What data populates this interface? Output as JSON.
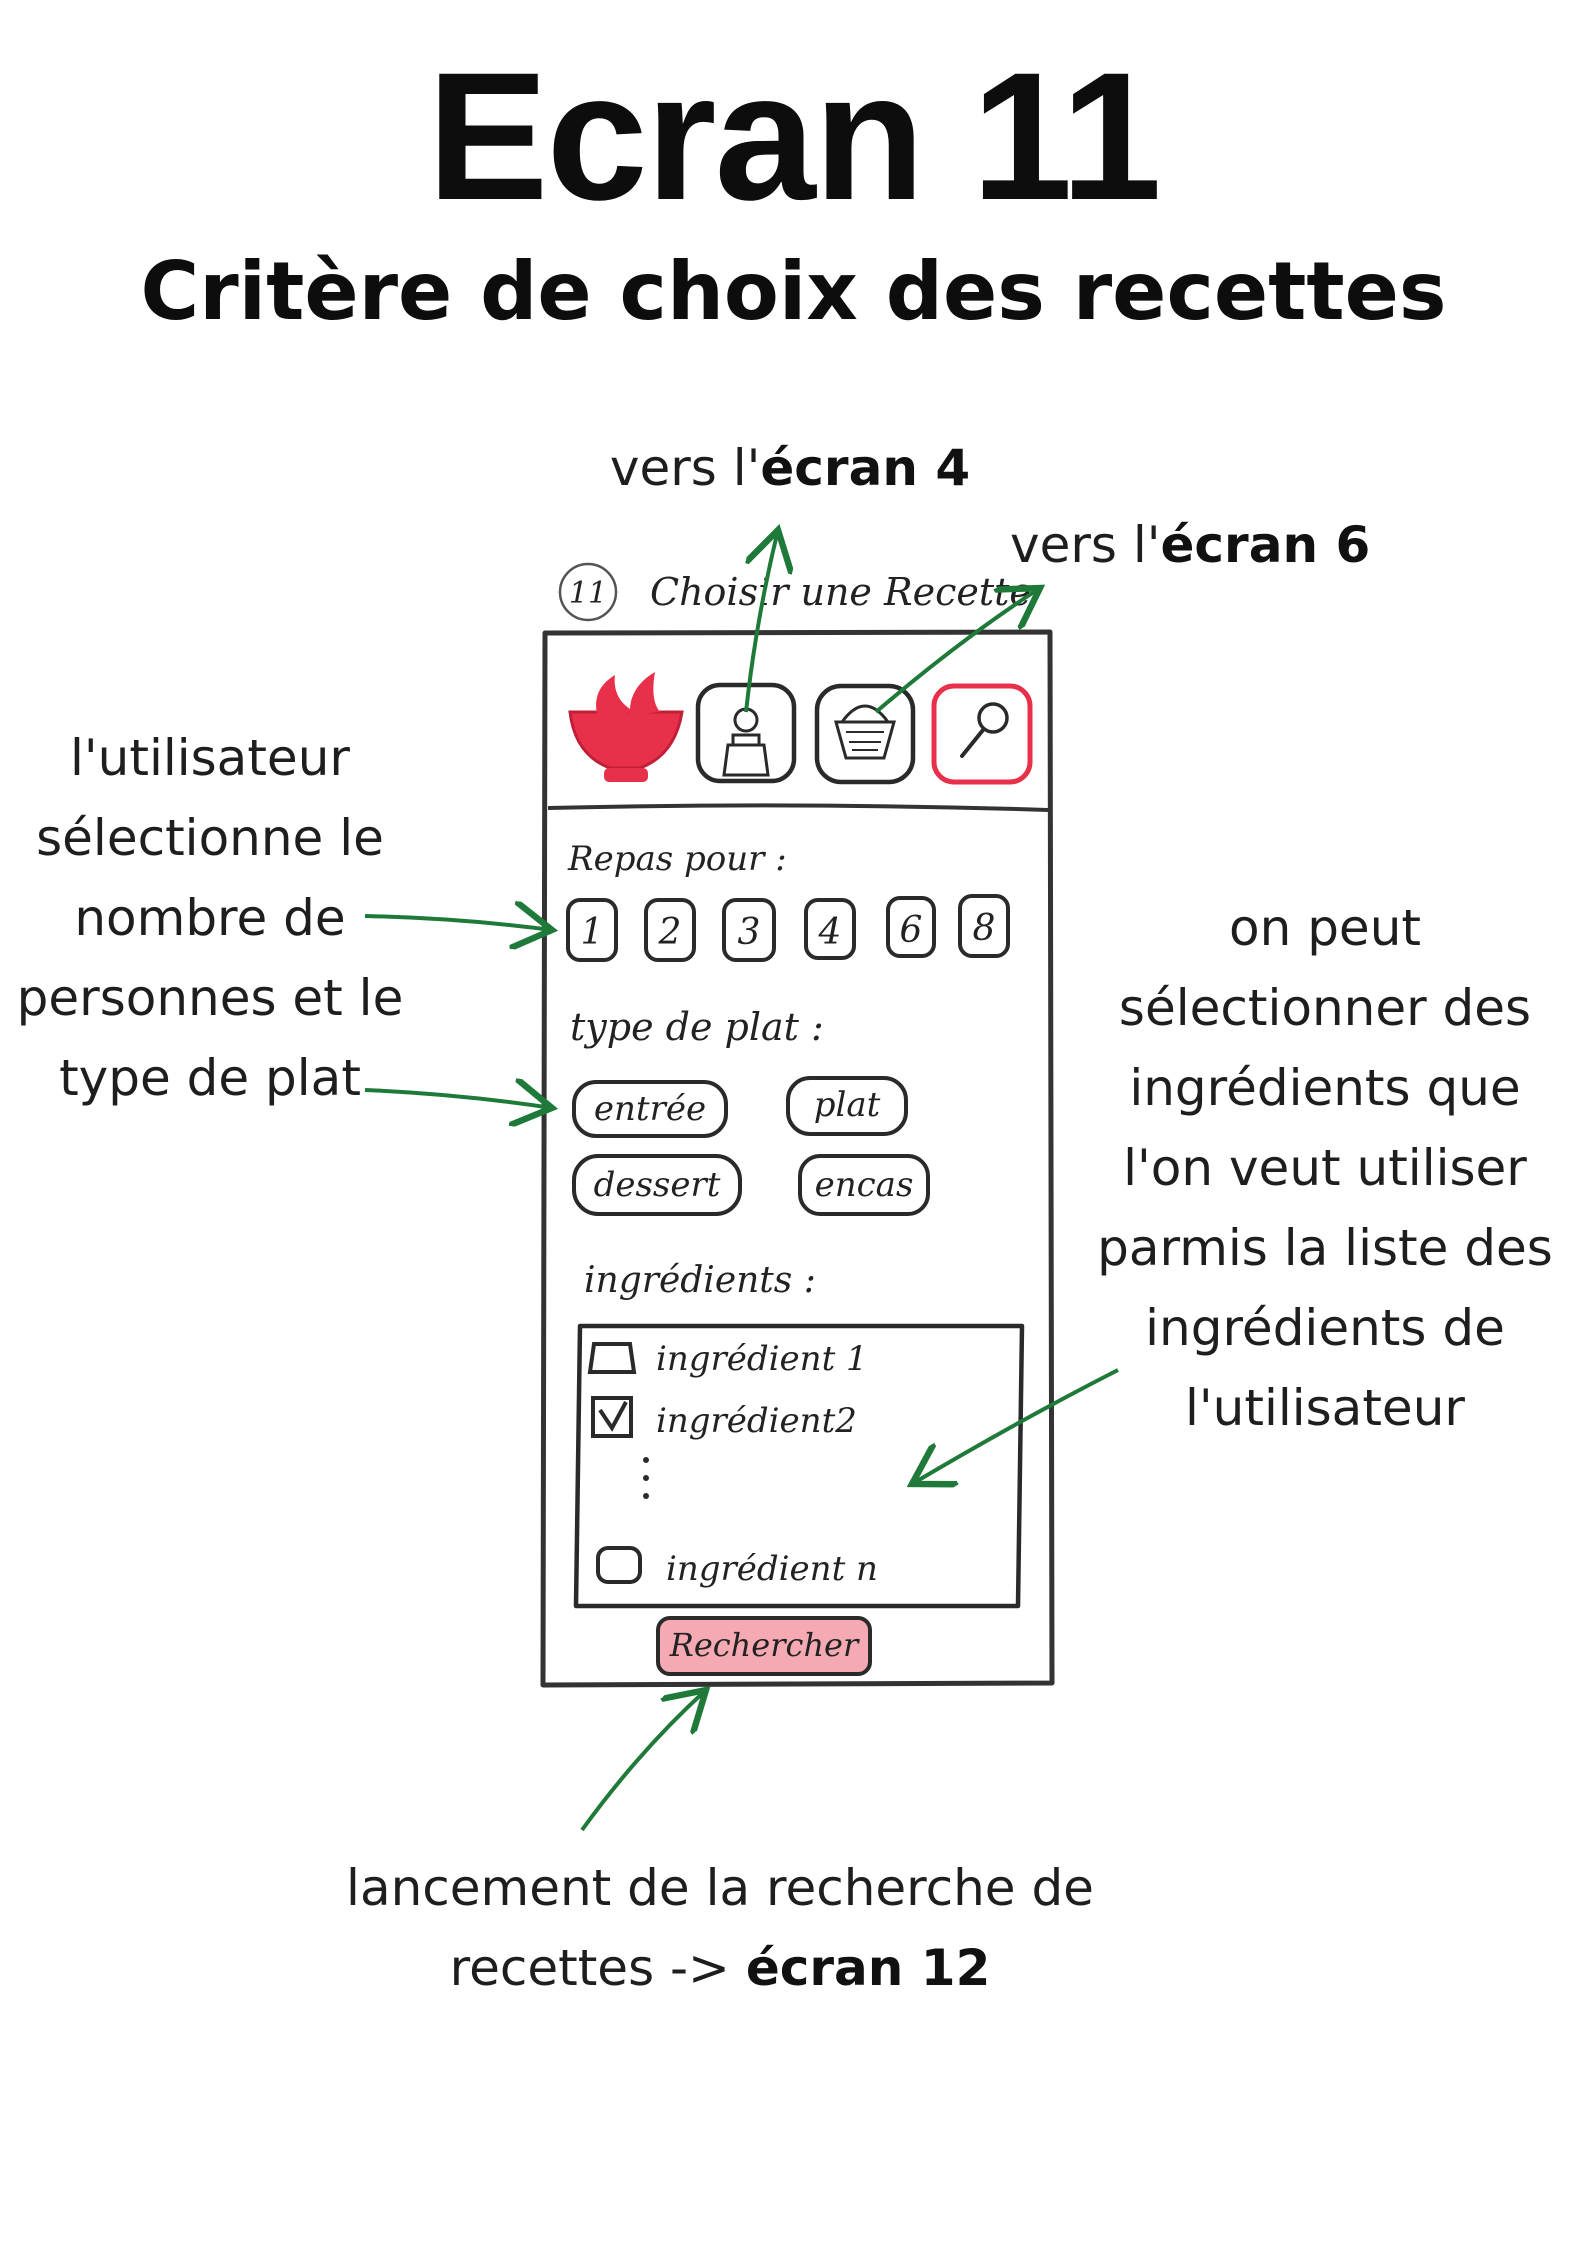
{
  "header": {
    "title": "Ecran 11",
    "subtitle": "Critère de choix des recettes"
  },
  "annotations": {
    "to_screen4": {
      "prefix": "vers l'",
      "bold": "écran 4"
    },
    "to_screen6": {
      "prefix": "vers l'",
      "bold": "écran 6"
    },
    "user_selects": [
      "l'utilisateur",
      "sélectionne le",
      "nombre de",
      "personnes et le",
      "type de plat"
    ],
    "ingredients_note": [
      "on peut",
      "sélectionner des",
      "ingrédients que",
      "l'on veut utiliser",
      "parmis la liste des",
      "ingrédients de",
      "l'utilisateur"
    ],
    "search_launch": {
      "line1": "lancement de la recherche de",
      "line2_prefix": "recettes -> ",
      "line2_bold": "écran 12"
    }
  },
  "sketch": {
    "screen_number": "11",
    "screen_label": "Choisir une Recette",
    "meal_label": "Repas pour :",
    "people_counts": [
      "1",
      "2",
      "3",
      "4",
      "6",
      "8"
    ],
    "dish_type_label": "type de plat :",
    "dish_types": [
      "entrée",
      "plat",
      "dessert",
      "encas"
    ],
    "ingredients_label": "ingrédients :",
    "ingredients": [
      {
        "name": "ingrédient 1",
        "checked": false
      },
      {
        "name": "ingrédient2",
        "checked": true
      },
      {
        "name": "ingrédient n",
        "checked": false
      }
    ],
    "search_button": "Rechercher",
    "colors": {
      "accent_red": "#e8304a",
      "button_pink": "#f4a9b3",
      "arrow_green": "#1f7a3a",
      "ink": "#222222"
    },
    "icons": [
      "bowl-logo-icon",
      "chef-hat-icon",
      "basket-icon",
      "search-icon"
    ]
  }
}
